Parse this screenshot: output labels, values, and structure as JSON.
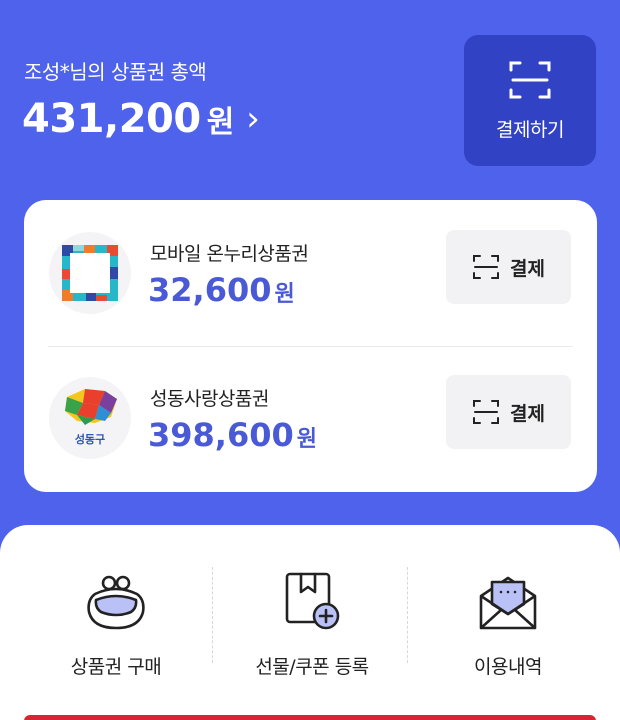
{
  "header": {
    "greeting": "조성*님의 상품권 총액",
    "total_amount": "431,200",
    "total_unit": "원",
    "chevron": "›",
    "pay_label": "결제하기"
  },
  "vouchers": [
    {
      "name": "모바일 온누리상품권",
      "amount": "32,600",
      "unit": "원",
      "pay_label": "결제",
      "logo_icon": "onnuri-logo-icon"
    },
    {
      "name": "성동사랑상품권",
      "amount": "398,600",
      "unit": "원",
      "pay_label": "결제",
      "logo_icon": "seongdong-logo-icon",
      "logo_text": "성동구"
    }
  ],
  "menu": [
    {
      "label": "상품권 구매",
      "icon": "wallet-icon"
    },
    {
      "label": "선물/쿠폰 등록",
      "icon": "gift-coupon-add-icon"
    },
    {
      "label": "이용내역",
      "icon": "envelope-history-icon"
    }
  ],
  "colors": {
    "brand_blue": "#4f62ec",
    "button_dark_blue": "#3143c4",
    "amount_blue": "#4a5ad6",
    "icon_lavender": "#b9c1f7",
    "accent_red": "#d8262f"
  }
}
